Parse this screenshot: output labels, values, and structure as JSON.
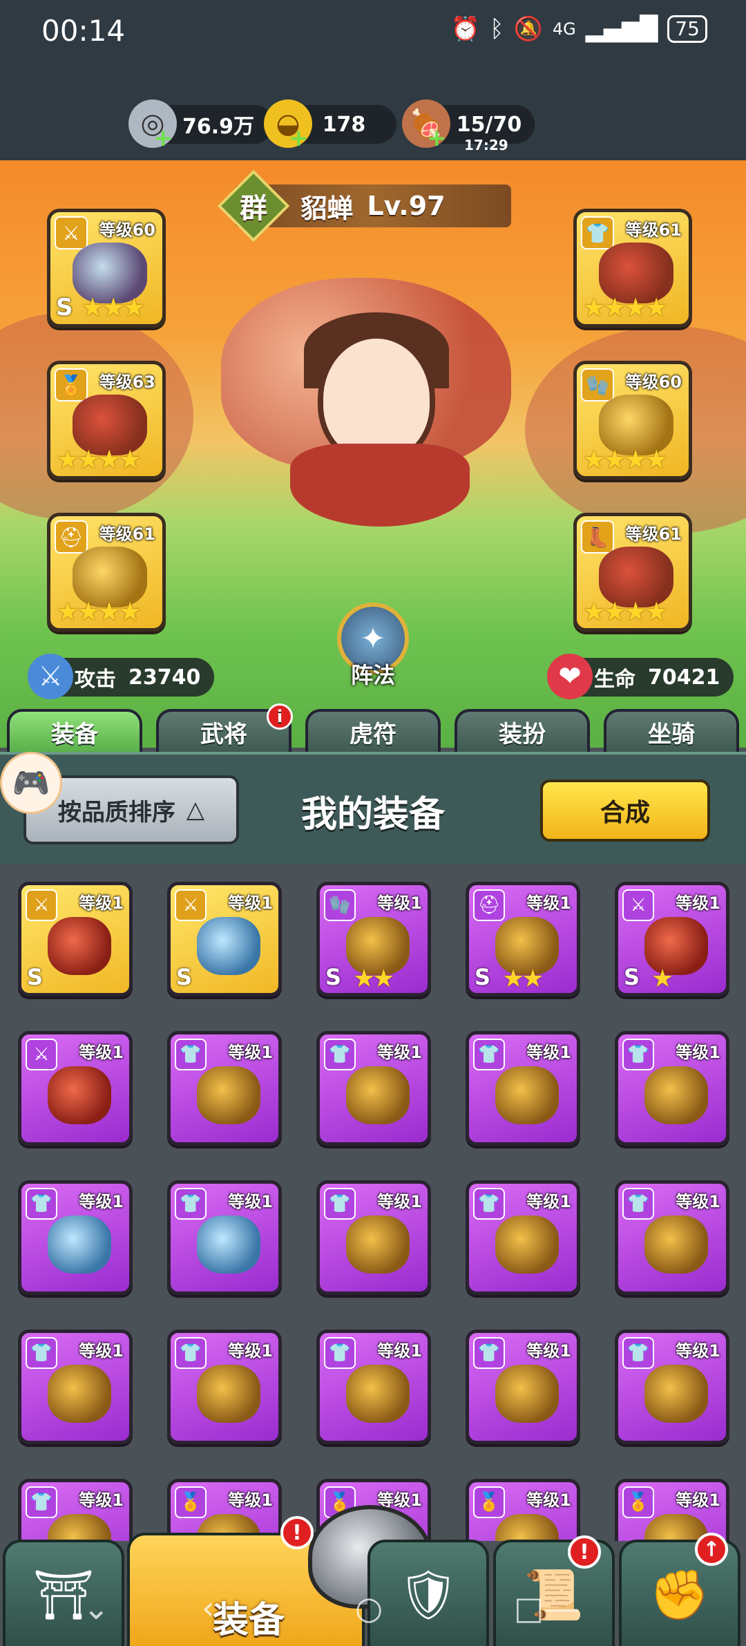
{
  "status": {
    "time": "00:14",
    "battery": "75",
    "signal": "4G"
  },
  "resources": [
    {
      "name": "silver",
      "value": "76.9万",
      "icon": "coin-icon"
    },
    {
      "name": "gold",
      "value": "178",
      "icon": "gold-ingot-icon"
    },
    {
      "name": "stamina",
      "value": "15/70",
      "timer": "17:29",
      "icon": "meat-icon"
    }
  ],
  "hero": {
    "faction": "群",
    "name": "貂蝉",
    "level": "Lv.97",
    "attack_label": "攻击",
    "attack_value": "23740",
    "hp_label": "生命",
    "hp_value": "70421",
    "formation_label": "阵法",
    "slots": [
      {
        "level": "等级60",
        "grade": "S",
        "stars": 3,
        "type": "weapon"
      },
      {
        "level": "等级63",
        "grade": "",
        "stars": 3,
        "type": "medal"
      },
      {
        "level": "等级61",
        "grade": "",
        "stars": 3,
        "type": "helmet"
      },
      {
        "level": "等级61",
        "grade": "",
        "stars": 4,
        "type": "armor"
      },
      {
        "level": "等级60",
        "grade": "",
        "stars": 4,
        "type": "gloves"
      },
      {
        "level": "等级61",
        "grade": "",
        "stars": 4,
        "type": "boots"
      }
    ]
  },
  "tabs": [
    {
      "label": "装备",
      "active": true,
      "badge": ""
    },
    {
      "label": "武将",
      "active": false,
      "badge": "i"
    },
    {
      "label": "虎符",
      "active": false,
      "badge": ""
    },
    {
      "label": "装扮",
      "active": false,
      "badge": ""
    },
    {
      "label": "坐骑",
      "active": false,
      "badge": ""
    }
  ],
  "panel": {
    "sort_label": "按品质排序",
    "title": "我的装备",
    "merge_label": "合成"
  },
  "inventory": [
    {
      "level": "等级1",
      "rarity": "gold",
      "grade": "S",
      "stars": 0,
      "type": "weapon"
    },
    {
      "level": "等级1",
      "rarity": "gold",
      "grade": "S",
      "stars": 0,
      "type": "weapon"
    },
    {
      "level": "等级1",
      "rarity": "purple",
      "grade": "S",
      "stars": 2,
      "type": "gloves"
    },
    {
      "level": "等级1",
      "rarity": "purple",
      "grade": "S",
      "stars": 2,
      "type": "helmet"
    },
    {
      "level": "等级1",
      "rarity": "purple",
      "grade": "S",
      "stars": 1,
      "type": "weapon"
    },
    {
      "level": "等级1",
      "rarity": "purple",
      "grade": "",
      "stars": 0,
      "type": "weapon"
    },
    {
      "level": "等级1",
      "rarity": "purple",
      "grade": "",
      "stars": 0,
      "type": "armor"
    },
    {
      "level": "等级1",
      "rarity": "purple",
      "grade": "",
      "stars": 0,
      "type": "armor"
    },
    {
      "level": "等级1",
      "rarity": "purple",
      "grade": "",
      "stars": 0,
      "type": "armor"
    },
    {
      "level": "等级1",
      "rarity": "purple",
      "grade": "",
      "stars": 0,
      "type": "armor"
    },
    {
      "level": "等级1",
      "rarity": "purple",
      "grade": "",
      "stars": 0,
      "type": "armor"
    },
    {
      "level": "等级1",
      "rarity": "purple",
      "grade": "",
      "stars": 0,
      "type": "armor"
    },
    {
      "level": "等级1",
      "rarity": "purple",
      "grade": "",
      "stars": 0,
      "type": "armor"
    },
    {
      "level": "等级1",
      "rarity": "purple",
      "grade": "",
      "stars": 0,
      "type": "armor"
    },
    {
      "level": "等级1",
      "rarity": "purple",
      "grade": "",
      "stars": 0,
      "type": "armor"
    },
    {
      "level": "等级1",
      "rarity": "purple",
      "grade": "",
      "stars": 0,
      "type": "armor"
    },
    {
      "level": "等级1",
      "rarity": "purple",
      "grade": "",
      "stars": 0,
      "type": "armor"
    },
    {
      "level": "等级1",
      "rarity": "purple",
      "grade": "",
      "stars": 0,
      "type": "armor"
    },
    {
      "level": "等级1",
      "rarity": "purple",
      "grade": "",
      "stars": 0,
      "type": "armor"
    },
    {
      "level": "等级1",
      "rarity": "purple",
      "grade": "",
      "stars": 0,
      "type": "armor"
    },
    {
      "level": "等级1",
      "rarity": "purple",
      "grade": "",
      "stars": 0,
      "type": "armor"
    },
    {
      "level": "等级1",
      "rarity": "purple",
      "grade": "",
      "stars": 0,
      "type": "medal"
    },
    {
      "level": "等级1",
      "rarity": "purple",
      "grade": "",
      "stars": 0,
      "type": "medal"
    },
    {
      "level": "等级1",
      "rarity": "purple",
      "grade": "",
      "stars": 0,
      "type": "medal"
    },
    {
      "level": "等级1",
      "rarity": "purple",
      "grade": "",
      "stars": 0,
      "type": "medal"
    }
  ],
  "bottom_nav": [
    {
      "label": "",
      "icon": "castle-gate-icon",
      "badge": ""
    },
    {
      "label": "装备",
      "icon": "helmet-icon",
      "badge": "!",
      "active": true
    },
    {
      "label": "",
      "icon": "crossed-swords-shield-icon",
      "badge": ""
    },
    {
      "label": "",
      "icon": "scroll-icon",
      "badge": "!"
    },
    {
      "label": "",
      "icon": "fist-upgrade-icon",
      "badge": "↑"
    }
  ],
  "colors": {
    "gold_card": "#f1b826",
    "purple_card": "#9a2cd0",
    "tab_active": "#5bb04a",
    "merge_button": "#f2b51a"
  }
}
